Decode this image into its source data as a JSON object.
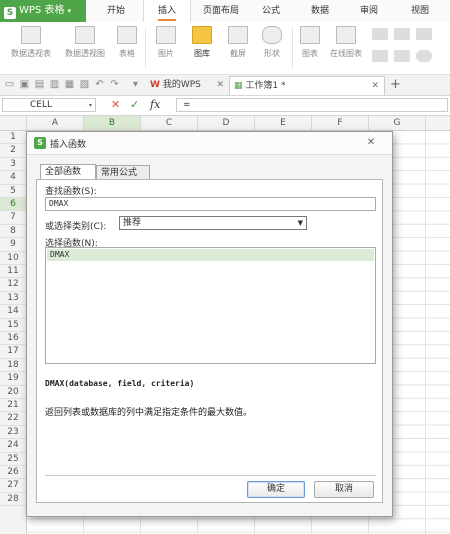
{
  "app": {
    "name": "WPS 表格"
  },
  "ribbon_tabs": [
    "开始",
    "插入",
    "页面布局",
    "公式",
    "数据",
    "审阅",
    "视图"
  ],
  "active_tab": "插入",
  "ribbon_buttons": [
    {
      "label": "数据透视表",
      "icon": "pivot-table-icon"
    },
    {
      "label": "数据透视图",
      "icon": "pivot-chart-icon"
    },
    {
      "label": "表格",
      "icon": "table-icon"
    },
    {
      "label": "图片",
      "icon": "picture-icon"
    },
    {
      "label": "图库",
      "icon": "gallery-icon"
    },
    {
      "label": "截屏",
      "icon": "screenshot-icon"
    },
    {
      "label": "形状",
      "icon": "shape-icon"
    },
    {
      "label": "图表",
      "icon": "chart-icon"
    },
    {
      "label": "在线图表",
      "icon": "online-chart-icon"
    }
  ],
  "doc_tabs": [
    {
      "label": "我的WPS"
    },
    {
      "label": "工作簿1 *"
    }
  ],
  "formula_bar": {
    "name_box": "CELL",
    "cancel_glyph": "✕",
    "confirm_glyph": "✓",
    "fx_label": "fx",
    "content": "="
  },
  "grid": {
    "columns": [
      "A",
      "B",
      "C",
      "D",
      "E",
      "F",
      "G"
    ],
    "selected_column": "B",
    "rows": [
      "1",
      "2",
      "3",
      "4",
      "5",
      "6",
      "7",
      "8",
      "9",
      "10",
      "11",
      "12",
      "13",
      "14",
      "15",
      "16",
      "17",
      "18",
      "19",
      "20",
      "21",
      "22",
      "23",
      "24",
      "25",
      "26",
      "27",
      "28"
    ],
    "selected_row": "6"
  },
  "dialog": {
    "title": "插入函数",
    "tabs": [
      "全部函数",
      "常用公式"
    ],
    "active_tab": "全部函数",
    "search_label": "查找函数(S):",
    "search_value": "DMAX",
    "category_label": "或选择类别(C):",
    "category_value": "推荐",
    "function_list_label": "选择函数(N):",
    "functions": [
      "DMAX"
    ],
    "selected_function": "DMAX",
    "syntax": "DMAX(database, field, criteria)",
    "description": "返回列表或数据库的列中满足指定条件的最大数值。",
    "ok_label": "确定",
    "cancel_label": "取消",
    "accent_color": "#4ea648"
  },
  "colors": {
    "brand_green": "#4ea648",
    "selection_green": "#dcebd6",
    "active_tab_underline": "#e8863a",
    "cancel_red": "#d9534f",
    "confirm_green": "#3a9a3a"
  }
}
